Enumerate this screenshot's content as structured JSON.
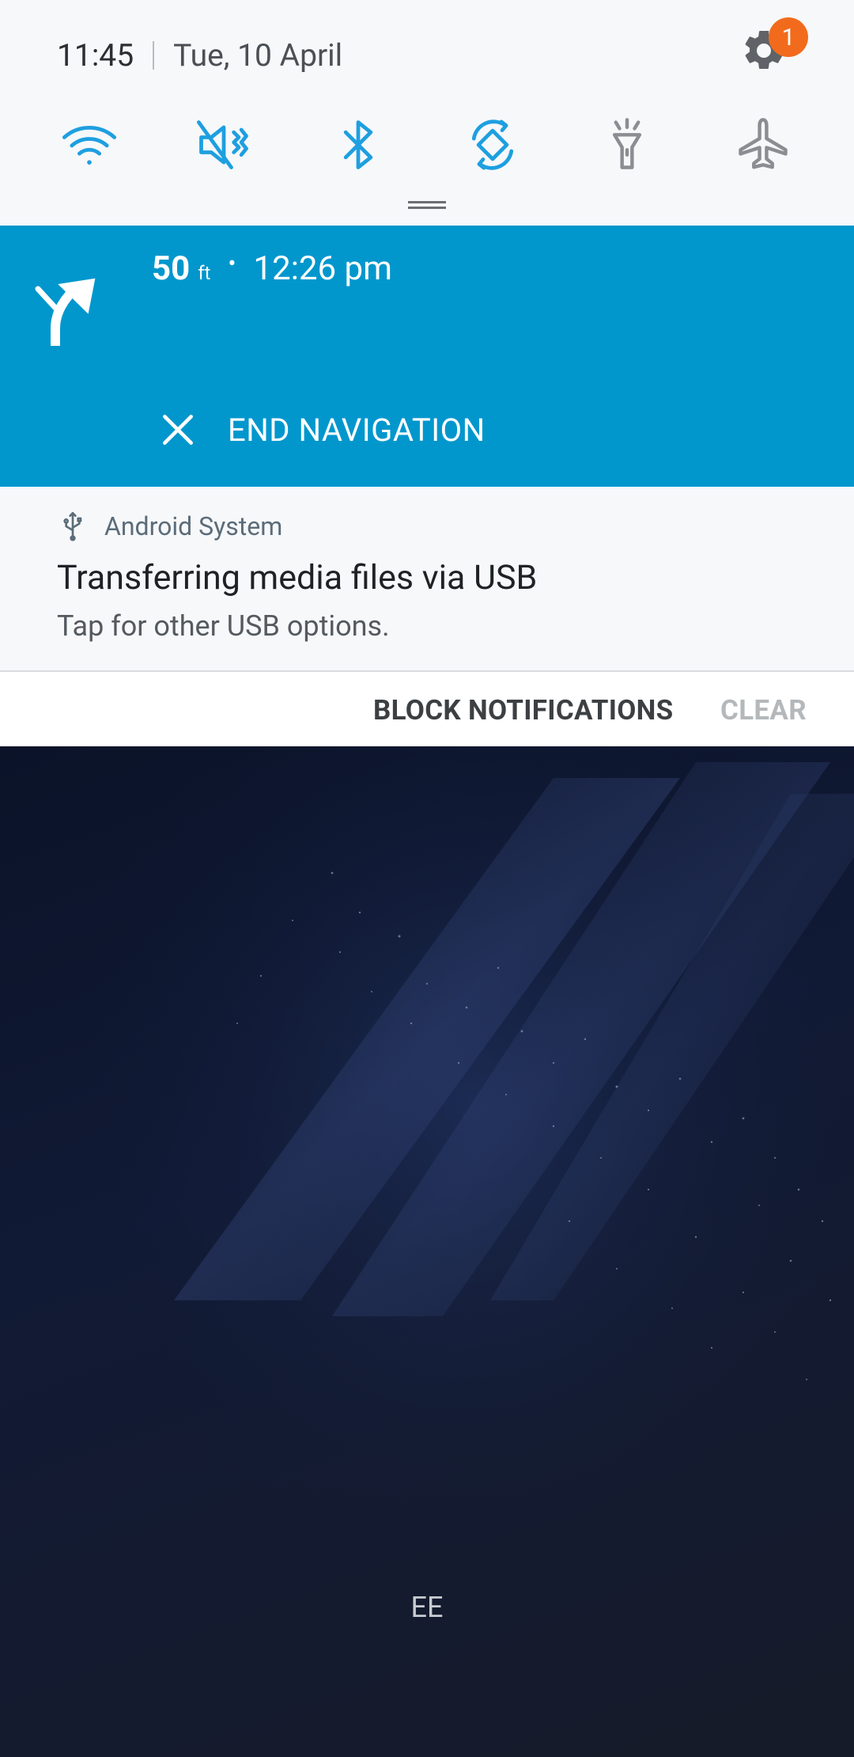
{
  "status": {
    "time": "11:45",
    "date": "Tue, 10 April",
    "settings_badge": "1"
  },
  "quick_toggles": [
    {
      "name": "wifi",
      "state": "on"
    },
    {
      "name": "sound-mute",
      "state": "on"
    },
    {
      "name": "bluetooth",
      "state": "on"
    },
    {
      "name": "auto-rotate",
      "state": "on"
    },
    {
      "name": "flashlight",
      "state": "off"
    },
    {
      "name": "airplane-mode",
      "state": "off"
    }
  ],
  "navigation": {
    "distance": "50",
    "unit": "ft",
    "eta": "12:26 pm",
    "end_label": "END NAVIGATION"
  },
  "usb_notification": {
    "app": "Android System",
    "title": "Transferring media files via USB",
    "subtitle": "Tap for other USB options."
  },
  "actions": {
    "block": "BLOCK NOTIFICATIONS",
    "clear": "CLEAR"
  },
  "carrier": "EE",
  "colors": {
    "nav_bg": "#0197cd",
    "accent_blue": "#1e9fe0",
    "badge": "#f26b1c"
  }
}
